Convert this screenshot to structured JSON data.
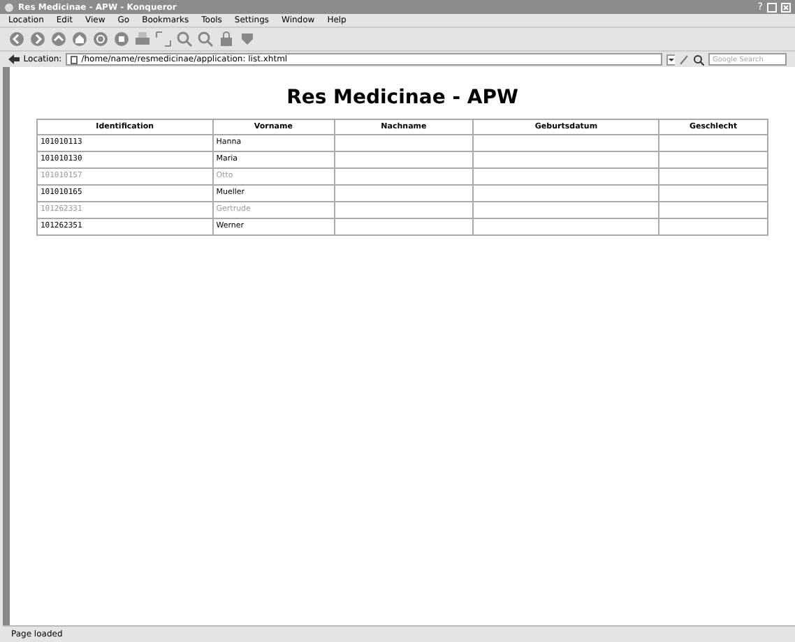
{
  "window": {
    "title": "Res Medicinae - APW - Konqueror",
    "controls": [
      "?"
    ]
  },
  "menu": [
    "Location",
    "Edit",
    "View",
    "Go",
    "Bookmarks",
    "Tools",
    "Settings",
    "Window",
    "Help"
  ],
  "location_bar": {
    "label": "Location:",
    "value": "/home/name/resmedicinae/application: list.xhtml",
    "search_placeholder": "Google Search"
  },
  "page": {
    "heading": "Res Medicinae - APW",
    "table": {
      "columns": [
        "Identification",
        "Vorname",
        "Nachname",
        "Geburtsdatum",
        "Geschlecht"
      ],
      "rows": [
        {
          "id": "101010113",
          "vorname": "Hanna",
          "greyed": false
        },
        {
          "id": "101010130",
          "vorname": "Maria",
          "greyed": false
        },
        {
          "id": "101010157",
          "vorname": "Otto",
          "greyed": true
        },
        {
          "id": "101010165",
          "vorname": "Mueller",
          "greyed": false
        },
        {
          "id": "101262331",
          "vorname": "Gertrude",
          "greyed": true
        },
        {
          "id": "101262351",
          "vorname": "Werner",
          "greyed": false
        }
      ]
    }
  },
  "status_bar": "Page loaded"
}
